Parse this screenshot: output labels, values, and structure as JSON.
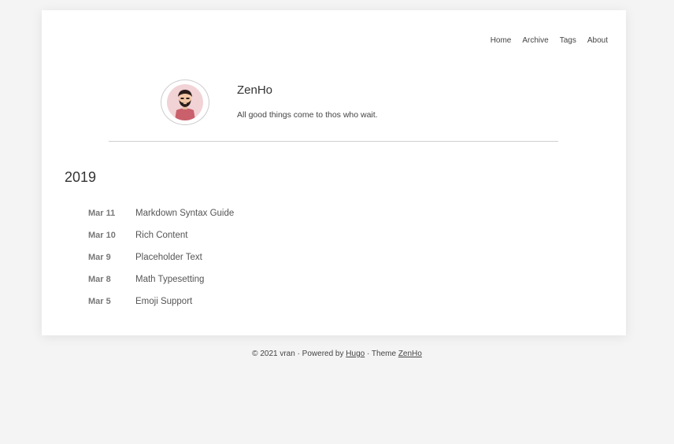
{
  "nav": {
    "items": [
      {
        "label": "Home"
      },
      {
        "label": "Archive"
      },
      {
        "label": "Tags"
      },
      {
        "label": "About"
      }
    ]
  },
  "profile": {
    "title": "ZenHo",
    "description": "All good things come to thos who wait."
  },
  "archive": {
    "year": "2019",
    "posts": [
      {
        "date": "Mar 11",
        "title": "Markdown Syntax Guide"
      },
      {
        "date": "Mar 10",
        "title": "Rich Content"
      },
      {
        "date": "Mar 9",
        "title": "Placeholder Text"
      },
      {
        "date": "Mar 8",
        "title": "Math Typesetting"
      },
      {
        "date": "Mar 5",
        "title": "Emoji Support"
      }
    ]
  },
  "footer": {
    "copyright": "© 2021 vran · Powered by",
    "hugo_label": "Hugo",
    "theme_text": "· Theme",
    "theme_label": "ZenHo"
  },
  "colors": {
    "background": "#f4f4f4",
    "card": "#ffffff",
    "avatar_bg": "#f1d2d5"
  }
}
